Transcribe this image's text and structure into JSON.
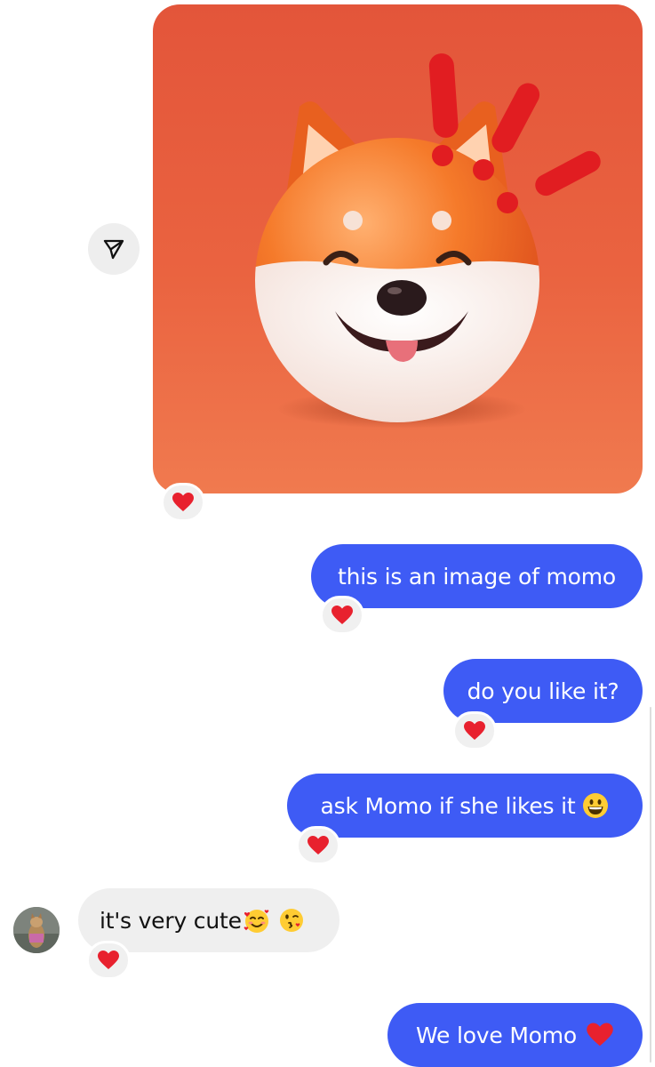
{
  "shared_post": {
    "image_description_icon": "shiba-dog-3d-render"
  },
  "messages": [
    {
      "id": "m1",
      "direction": "outgoing",
      "text": "this is an image of momo",
      "reaction": "heart-icon"
    },
    {
      "id": "m2",
      "direction": "outgoing",
      "text": "do you like it?",
      "reaction": "heart-icon"
    },
    {
      "id": "m3",
      "direction": "outgoing",
      "text": "ask Momo if she likes it",
      "emojis": [
        "grinning-face-emoji"
      ],
      "reaction": "heart-icon"
    },
    {
      "id": "m4",
      "direction": "incoming",
      "text": "it's very cute",
      "emojis": [
        "smiling-face-with-hearts-emoji",
        "face-blowing-kiss-emoji"
      ],
      "reaction": "heart-icon"
    },
    {
      "id": "m5",
      "direction": "outgoing",
      "text": "We love Momo",
      "emojis": [
        "red-heart-emoji"
      ]
    }
  ],
  "colors": {
    "outgoing_bubble": "#3e5bf5",
    "incoming_bubble": "#efefef",
    "reaction_badge": "#f0f0f0",
    "heart": "#e8212e",
    "image_background": "#e3553a"
  }
}
